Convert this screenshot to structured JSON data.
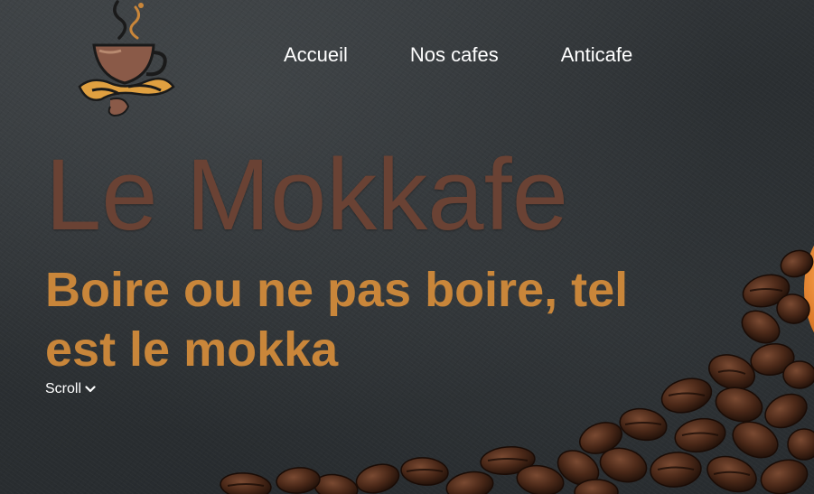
{
  "header": {
    "logo_icon": "coffee-cup-logo-icon"
  },
  "nav": {
    "items": [
      {
        "label": "Accueil"
      },
      {
        "label": "Nos cafes"
      },
      {
        "label": "Anticafe"
      }
    ]
  },
  "hero": {
    "title": "Le Mokkafe",
    "tagline": "Boire ou ne pas boire, tel est le mokka",
    "scroll_label": "Scroll",
    "scroll_icon": "chevron-down-icon"
  },
  "colors": {
    "background": "#2b2f32",
    "title": "#6a4234",
    "tagline": "#c9863a",
    "nav_text": "#ffffff",
    "bean": "#3b1f14",
    "accent_orange": "#e0781c"
  }
}
